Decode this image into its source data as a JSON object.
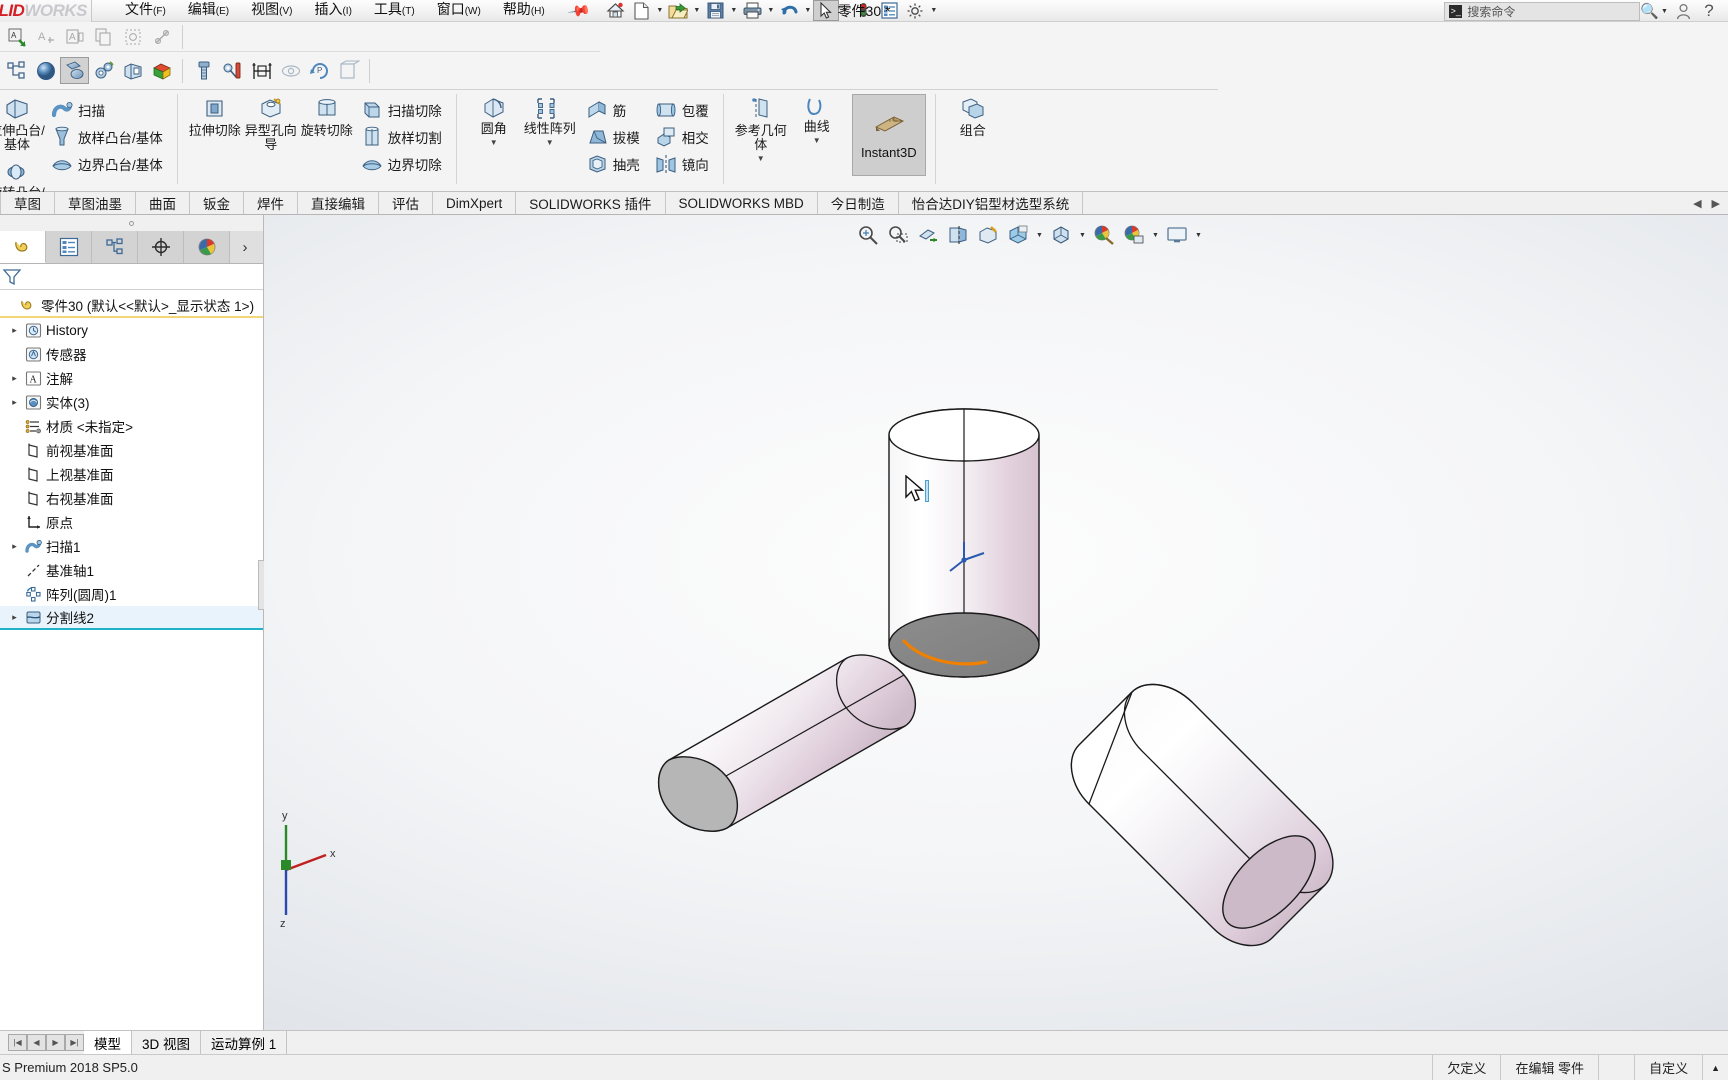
{
  "app": {
    "logo_a": "LID",
    "logo_b": "WORKS",
    "document_title": "零件30 *",
    "version_status": "S Premium 2018 SP5.0"
  },
  "menu": {
    "items": [
      {
        "label": "文件",
        "accel": "(F)"
      },
      {
        "label": "编辑",
        "accel": "(E)"
      },
      {
        "label": "视图",
        "accel": "(V)"
      },
      {
        "label": "插入",
        "accel": "(I)"
      },
      {
        "label": "工具",
        "accel": "(T)"
      },
      {
        "label": "窗口",
        "accel": "(W)"
      },
      {
        "label": "帮助",
        "accel": "(H)"
      }
    ],
    "pin_icon": "pin-icon"
  },
  "quick_access": {
    "buttons": [
      {
        "name": "home-icon",
        "caret": false
      },
      {
        "name": "new-document-icon",
        "caret": true
      },
      {
        "name": "open-folder-icon",
        "caret": true
      },
      {
        "name": "save-icon",
        "caret": true
      },
      {
        "name": "print-icon",
        "caret": true
      },
      {
        "name": "undo-icon",
        "caret": true
      },
      {
        "name": "select-cursor-icon",
        "caret": true,
        "selected": true
      },
      {
        "name": "rebuild-traffic-light-icon",
        "caret": false
      },
      {
        "name": "file-properties-icon",
        "caret": false
      },
      {
        "name": "options-gear-icon",
        "caret": true
      }
    ]
  },
  "search": {
    "placeholder": "搜索命令",
    "icon": "search-command-icon",
    "magnifier_icon": "magnifier-icon",
    "account_icon": "user-account-icon",
    "help_icon": "help-question-icon"
  },
  "ribbon": {
    "row1_icons": [
      "edit-sketch-icon",
      "add-dimension-icon",
      "smart-dimension-icon",
      "copy-entities-icon",
      "pattern-icon",
      "sketch-relation-icon"
    ],
    "row2_icons": [
      "feature-tree-icon",
      "sphere-shaded-icon",
      "instant3d-toggle-icon",
      "gear-feature-icon",
      "extrude-wizard-icon",
      "appearance-icon",
      "bolt-fastener-icon",
      "toolbox-icon",
      "dimxpert-icon",
      "display-state-icon",
      "pattern-driven-icon",
      "section-view-icon"
    ],
    "groups": [
      {
        "name": "boss-base-group",
        "big": [
          {
            "label": "拉伸凸台/基体",
            "icon": "extruded-boss-icon"
          }
        ],
        "big2": [
          {
            "label": "旋转凸台/基体",
            "icon": "revolved-boss-icon"
          }
        ],
        "rows": [
          {
            "label": "扫描",
            "icon": "swept-boss-icon"
          },
          {
            "label": "放样凸台/基体",
            "icon": "lofted-boss-icon"
          },
          {
            "label": "边界凸台/基体",
            "icon": "boundary-boss-icon"
          }
        ]
      },
      {
        "name": "cut-group",
        "big": [
          {
            "label": "拉伸切除",
            "icon": "extruded-cut-icon"
          },
          {
            "label": "异型孔向导",
            "icon": "hole-wizard-icon"
          },
          {
            "label": "旋转切除",
            "icon": "revolved-cut-icon"
          }
        ],
        "rows": [
          {
            "label": "扫描切除",
            "icon": "swept-cut-icon"
          },
          {
            "label": "放样切割",
            "icon": "lofted-cut-icon"
          },
          {
            "label": "边界切除",
            "icon": "boundary-cut-icon"
          }
        ]
      },
      {
        "name": "feature-group",
        "big": [
          {
            "label": "圆角",
            "icon": "fillet-icon"
          },
          {
            "label": "线性阵列",
            "icon": "linear-pattern-icon"
          }
        ],
        "rows": [
          {
            "label": "筋",
            "icon": "rib-icon"
          },
          {
            "label": "拔模",
            "icon": "draft-icon"
          },
          {
            "label": "抽壳",
            "icon": "shell-icon"
          }
        ],
        "rows2": [
          {
            "label": "包覆",
            "icon": "wrap-icon"
          },
          {
            "label": "相交",
            "icon": "intersect-icon"
          },
          {
            "label": "镜向",
            "icon": "mirror-icon"
          }
        ]
      },
      {
        "name": "reference-group",
        "big": [
          {
            "label": "参考几何体",
            "icon": "reference-geometry-icon"
          },
          {
            "label": "曲线",
            "icon": "curves-icon"
          }
        ]
      },
      {
        "name": "instant3d-group",
        "toggle": {
          "label": "Instant3D",
          "icon": "instant3d-icon",
          "active": true
        }
      },
      {
        "name": "combine-group",
        "big": [
          {
            "label": "组合",
            "icon": "combine-icon"
          }
        ]
      }
    ]
  },
  "ribbon_tabs": {
    "items": [
      {
        "label": "草图"
      },
      {
        "label": "草图油墨"
      },
      {
        "label": "曲面"
      },
      {
        "label": "钣金"
      },
      {
        "label": "焊件"
      },
      {
        "label": "直接编辑"
      },
      {
        "label": "评估"
      },
      {
        "label": "DimXpert"
      },
      {
        "label": "SOLIDWORKS 插件"
      },
      {
        "label": "SOLIDWORKS MBD"
      },
      {
        "label": "今日制造"
      },
      {
        "label": "怡合达DIY铝型材选型系统"
      }
    ]
  },
  "left_panel": {
    "tabs": [
      {
        "name": "feature-manager-tab",
        "icon": "feature-tree-yellow-icon",
        "active": true
      },
      {
        "name": "property-manager-tab",
        "icon": "property-list-icon",
        "active": false
      },
      {
        "name": "configuration-manager-tab",
        "icon": "configuration-icon",
        "active": false
      },
      {
        "name": "dimxpert-manager-tab",
        "icon": "dimxpert-target-icon",
        "active": false
      },
      {
        "name": "display-manager-tab",
        "icon": "display-palette-icon",
        "active": false
      }
    ],
    "more_icon": "chevron-right-icon",
    "filter_icon": "filter-funnel-icon",
    "tree": [
      {
        "label": "零件30  (默认<<默认>_显示状态 1>)",
        "icon": "part-root-icon",
        "arrow": false,
        "depth": 0,
        "root": true
      },
      {
        "label": "History",
        "icon": "history-icon",
        "arrow": true,
        "depth": 1
      },
      {
        "label": "传感器",
        "icon": "sensors-icon",
        "arrow": false,
        "depth": 1
      },
      {
        "label": "注解",
        "icon": "annotations-icon",
        "arrow": true,
        "depth": 1
      },
      {
        "label": "实体(3)",
        "icon": "solid-bodies-icon",
        "arrow": true,
        "depth": 1
      },
      {
        "label": "材质 <未指定>",
        "icon": "material-icon",
        "arrow": false,
        "depth": 1
      },
      {
        "label": "前视基准面",
        "icon": "plane-icon",
        "arrow": false,
        "depth": 1
      },
      {
        "label": "上视基准面",
        "icon": "plane-icon",
        "arrow": false,
        "depth": 1
      },
      {
        "label": "右视基准面",
        "icon": "plane-icon",
        "arrow": false,
        "depth": 1
      },
      {
        "label": "原点",
        "icon": "origin-icon",
        "arrow": false,
        "depth": 1
      },
      {
        "label": "扫描1",
        "icon": "sweep-feature-icon",
        "arrow": true,
        "depth": 1
      },
      {
        "label": "基准轴1",
        "icon": "axis-icon",
        "arrow": false,
        "depth": 1
      },
      {
        "label": "阵列(圆周)1",
        "icon": "circular-pattern-icon",
        "arrow": false,
        "depth": 1
      },
      {
        "label": "分割线2",
        "icon": "split-line-icon",
        "arrow": true,
        "depth": 1,
        "selected": true
      }
    ]
  },
  "viewport": {
    "toolbar_buttons": [
      {
        "name": "zoom-to-fit-icon",
        "caret": false
      },
      {
        "name": "zoom-to-area-icon",
        "caret": false
      },
      {
        "name": "previous-view-icon",
        "caret": false
      },
      {
        "name": "section-view-icon",
        "caret": false
      },
      {
        "name": "view-orientation-icon",
        "caret": false
      },
      {
        "name": "display-style-icon",
        "caret": true
      },
      {
        "name": "hide-show-items-icon",
        "caret": true
      },
      {
        "name": "edit-appearance-icon",
        "caret": false
      },
      {
        "name": "apply-scene-icon",
        "caret": true
      },
      {
        "name": "view-settings-icon",
        "caret": true
      }
    ],
    "triad_labels": {
      "x": "x",
      "y": "y",
      "z": "z"
    },
    "highlight_color": "#f08000",
    "bodies": [
      {
        "name": "cylinder-upper",
        "orientation": "vertical"
      },
      {
        "name": "cylinder-lower-left",
        "orientation": "tilted-left"
      },
      {
        "name": "cylinder-lower-right",
        "orientation": "tilted-right"
      }
    ]
  },
  "bottom_tabs": {
    "nav_icons": [
      "first-icon",
      "prev-icon",
      "next-icon",
      "last-icon"
    ],
    "items": [
      {
        "label": "模型",
        "active": true
      },
      {
        "label": "3D 视图",
        "active": false
      },
      {
        "label": "运动算例 1",
        "active": false
      }
    ]
  },
  "status_bar": {
    "left": "S Premium 2018 SP5.0",
    "cells": [
      "欠定义",
      "在编辑 零件",
      "",
      "自定义"
    ],
    "expand_icon": "caret-up-icon"
  }
}
